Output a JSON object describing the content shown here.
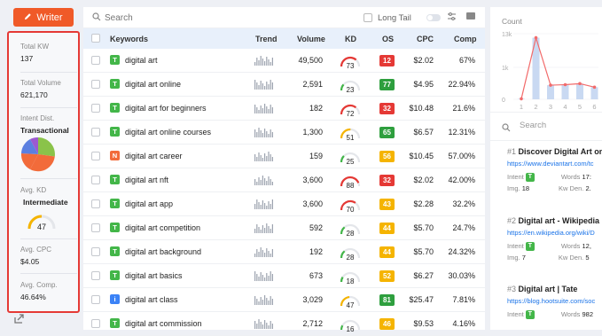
{
  "app": {
    "writer_label": "Writer"
  },
  "summary": {
    "total_kw_label": "Total KW",
    "total_kw": "137",
    "total_volume_label": "Total Volume",
    "total_volume": "621,170",
    "intent_label": "Intent Dist.",
    "intent_value": "Transactional",
    "avg_kd_label": "Avg. KD",
    "avg_kd_text": "Intermediate",
    "avg_kd_value": "47",
    "avg_cpc_label": "Avg. CPC",
    "avg_cpc": "$4.05",
    "avg_comp_label": "Avg. Comp.",
    "avg_comp": "46.64%"
  },
  "toolbar": {
    "search_placeholder": "Search",
    "long_tail_label": "Long Tail"
  },
  "table": {
    "headers": {
      "keywords": "Keywords",
      "trend": "Trend",
      "volume": "Volume",
      "kd": "KD",
      "os": "OS",
      "cpc": "CPC",
      "comp": "Comp"
    },
    "rows": [
      {
        "intent": "T",
        "intent_color": "#43b649",
        "keyword": "digital art",
        "volume": "49,500",
        "kd": "73",
        "os": "12",
        "os_color": "#e53935",
        "cpc": "$2.02",
        "comp": "67%"
      },
      {
        "intent": "T",
        "intent_color": "#43b649",
        "keyword": "digital art online",
        "volume": "2,591",
        "kd": "23",
        "os": "77",
        "os_color": "#2e9f3e",
        "cpc": "$4.95",
        "comp": "22.94%"
      },
      {
        "intent": "T",
        "intent_color": "#43b649",
        "keyword": "digital art for beginners",
        "volume": "182",
        "kd": "72",
        "os": "32",
        "os_color": "#e53935",
        "cpc": "$10.48",
        "comp": "21.6%"
      },
      {
        "intent": "T",
        "intent_color": "#43b649",
        "keyword": "digital art online courses",
        "volume": "1,300",
        "kd": "51",
        "os": "65",
        "os_color": "#2e9f3e",
        "cpc": "$6.57",
        "comp": "12.31%"
      },
      {
        "intent": "N",
        "intent_color": "#f26b3a",
        "keyword": "digital art career",
        "volume": "159",
        "kd": "25",
        "os": "56",
        "os_color": "#f5b400",
        "cpc": "$10.45",
        "comp": "57.00%"
      },
      {
        "intent": "T",
        "intent_color": "#43b649",
        "keyword": "digital art nft",
        "volume": "3,600",
        "kd": "88",
        "os": "32",
        "os_color": "#e53935",
        "cpc": "$2.02",
        "comp": "42.00%"
      },
      {
        "intent": "T",
        "intent_color": "#43b649",
        "keyword": "digital art app",
        "volume": "3,600",
        "kd": "70",
        "os": "43",
        "os_color": "#f5b400",
        "cpc": "$2.28",
        "comp": "32.2%"
      },
      {
        "intent": "T",
        "intent_color": "#43b649",
        "keyword": "digital art competition",
        "volume": "592",
        "kd": "28",
        "os": "44",
        "os_color": "#f5b400",
        "cpc": "$5.70",
        "comp": "24.7%"
      },
      {
        "intent": "T",
        "intent_color": "#43b649",
        "keyword": "digital art background",
        "volume": "192",
        "kd": "28",
        "os": "44",
        "os_color": "#f5b400",
        "cpc": "$5.70",
        "comp": "24.32%"
      },
      {
        "intent": "T",
        "intent_color": "#43b649",
        "keyword": "digital art basics",
        "volume": "673",
        "kd": "18",
        "os": "52",
        "os_color": "#f5b400",
        "cpc": "$6.27",
        "comp": "30.03%"
      },
      {
        "intent": "i",
        "intent_color": "#3b82f6",
        "keyword": "digital art class",
        "volume": "3,029",
        "kd": "47",
        "os": "81",
        "os_color": "#2e9f3e",
        "cpc": "$25.47",
        "comp": "7.81%"
      },
      {
        "intent": "T",
        "intent_color": "#43b649",
        "keyword": "digital art commission",
        "volume": "2,712",
        "kd": "16",
        "os": "46",
        "os_color": "#f5b400",
        "cpc": "$9.53",
        "comp": "4.16%"
      }
    ]
  },
  "right": {
    "chart_label": "Count",
    "search_placeholder": "Search",
    "results": [
      {
        "num": "#1",
        "title": "Discover Digital Art on",
        "url": "https://www.deviantart.com/tc",
        "intent_label": "Intent",
        "intent": "T",
        "words_label": "Words",
        "words": "17:",
        "img_label": "Img.",
        "img": "18",
        "kwden_label": "Kw Den.",
        "kwden": "2."
      },
      {
        "num": "#2",
        "title": "Digital art - Wikipedia",
        "url": "https://en.wikipedia.org/wiki/D",
        "intent_label": "Intent",
        "intent": "T",
        "words_label": "Words",
        "words": "12,",
        "img_label": "Img.",
        "img": "7",
        "kwden_label": "Kw Den.",
        "kwden": "5"
      },
      {
        "num": "#3",
        "title": "Digital art | Tate",
        "url": "https://blog.hootsuite.com/soc",
        "intent_label": "Intent",
        "intent": "T",
        "words_label": "Words",
        "words": "982"
      }
    ]
  },
  "chart_data": {
    "type": "bar",
    "categories": [
      "1",
      "2",
      "3",
      "4",
      "5",
      "6"
    ],
    "values": [
      0.1,
      12.2,
      2.8,
      2.9,
      3.1,
      2.4
    ],
    "y_ticks": [
      "13k",
      "1k",
      "0"
    ],
    "bar_color": "#c9d9f2",
    "line_color": "#f26b6b"
  },
  "colors": {
    "accent": "#f05a28",
    "highlight_border": "#e53935",
    "header_bg": "#e8f0fb",
    "link": "#1a73e8"
  }
}
